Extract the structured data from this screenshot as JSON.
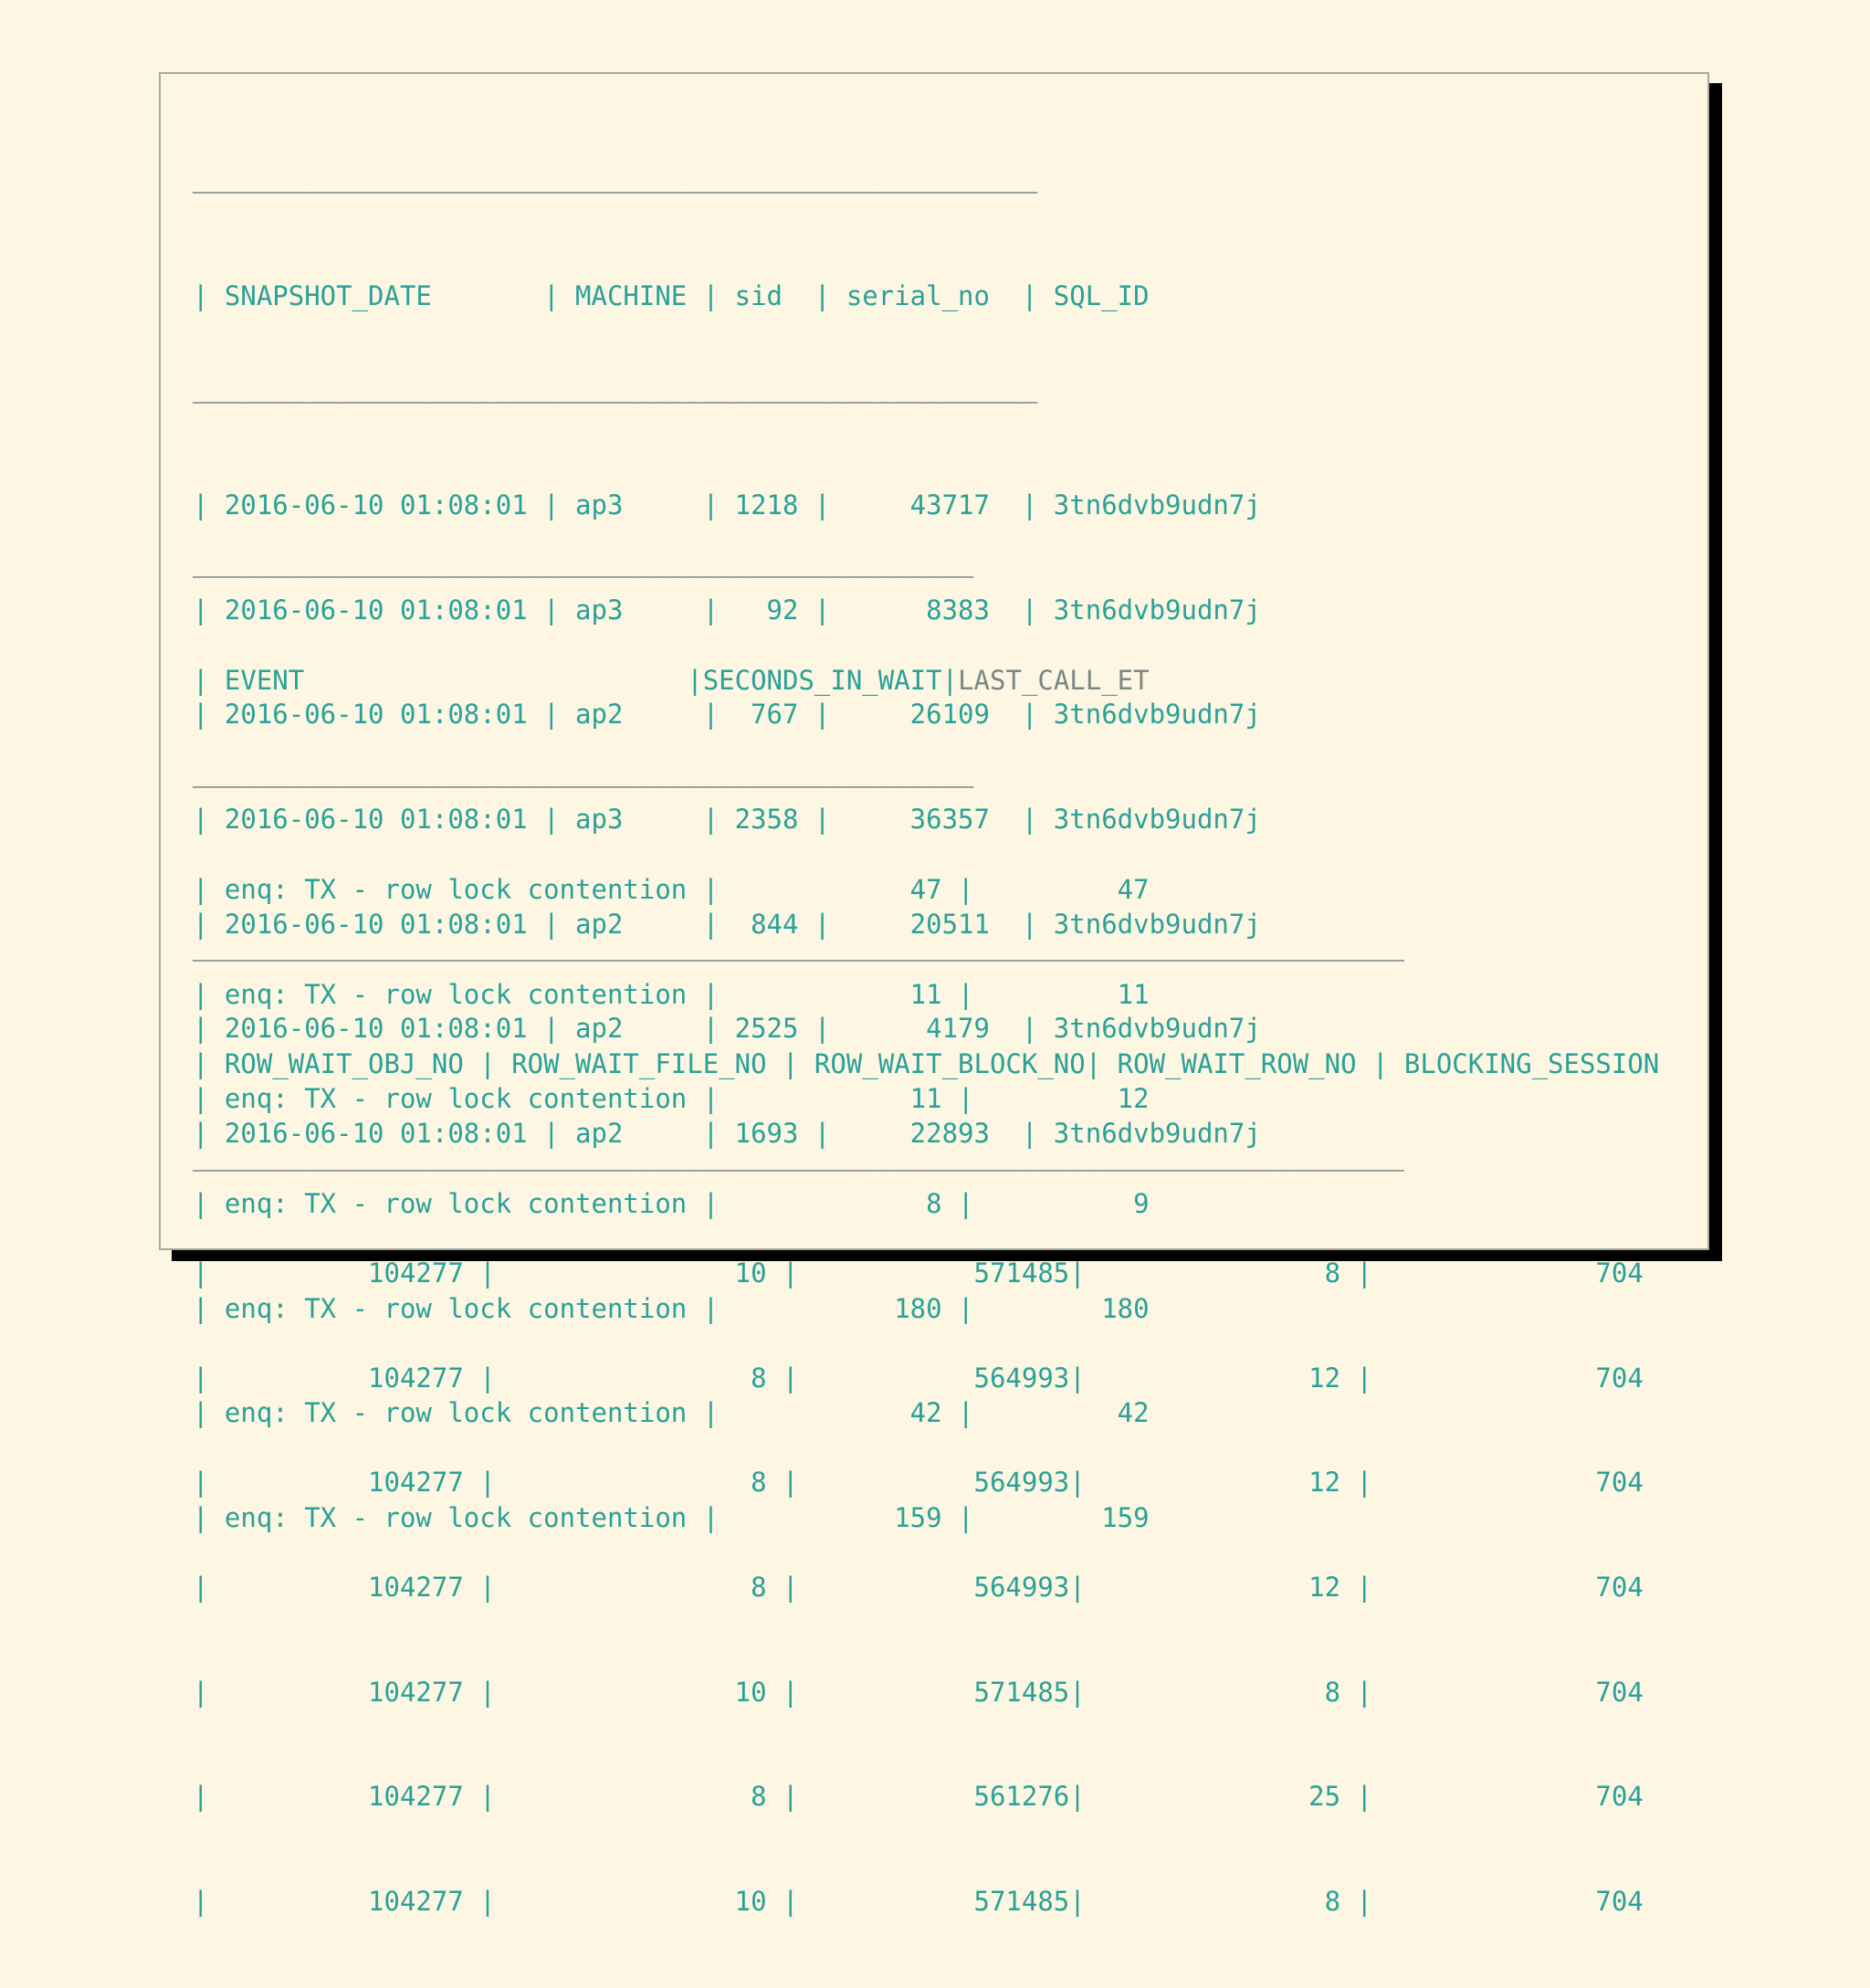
{
  "tables": [
    {
      "rule": "―――――――――――――――――――――――――――――――――――――――――――――――――――――",
      "header": "| SNAPSHOT_DATE       | MACHINE | sid  | serial_no  | SQL_ID",
      "rows": [
        "| 2016-06-10 01:08:01 | ap3     | 1218 |     43717  | 3tn6dvb9udn7j",
        "| 2016-06-10 01:08:01 | ap3     |   92 |      8383  | 3tn6dvb9udn7j",
        "| 2016-06-10 01:08:01 | ap2     |  767 |     26109  | 3tn6dvb9udn7j",
        "| 2016-06-10 01:08:01 | ap3     | 2358 |     36357  | 3tn6dvb9udn7j",
        "| 2016-06-10 01:08:01 | ap2     |  844 |     20511  | 3tn6dvb9udn7j",
        "| 2016-06-10 01:08:01 | ap2     | 2525 |      4179  | 3tn6dvb9udn7j",
        "| 2016-06-10 01:08:01 | ap2     | 1693 |     22893  | 3tn6dvb9udn7j"
      ]
    },
    {
      "rule": "―――――――――――――――――――――――――――――――――――――――――――――――――",
      "header_main": "| EVENT                        |SECONDS_IN_WAIT|",
      "header_last": "LAST_CALL_ET",
      "rows": [
        "| enq: TX - row lock contention |            47 |         47",
        "| enq: TX - row lock contention |            11 |         11",
        "| enq: TX - row lock contention |            11 |         12",
        "| enq: TX - row lock contention |             8 |          9",
        "| enq: TX - row lock contention |           180 |        180",
        "| enq: TX - row lock contention |            42 |         42",
        "| enq: TX - row lock contention |           159 |        159"
      ]
    },
    {
      "rule": "――――――――――――――――――――――――――――――――――――――――――――――――――――――――――――――――――――――――――――",
      "header": "| ROW_WAIT_OBJ_NO | ROW_WAIT_FILE_NO | ROW_WAIT_BLOCK_NO| ROW_WAIT_ROW_NO | BLOCKING_SESSION",
      "rows": [
        "|          104277 |               10 |           571485|               8 |              704",
        "|          104277 |                8 |           564993|              12 |              704",
        "|          104277 |                8 |           564993|              12 |              704",
        "|          104277 |                8 |           564993|              12 |              704",
        "|          104277 |               10 |           571485|               8 |              704",
        "|          104277 |                8 |           561276|              25 |              704",
        "|          104277 |               10 |           571485|               8 |              704"
      ]
    }
  ]
}
